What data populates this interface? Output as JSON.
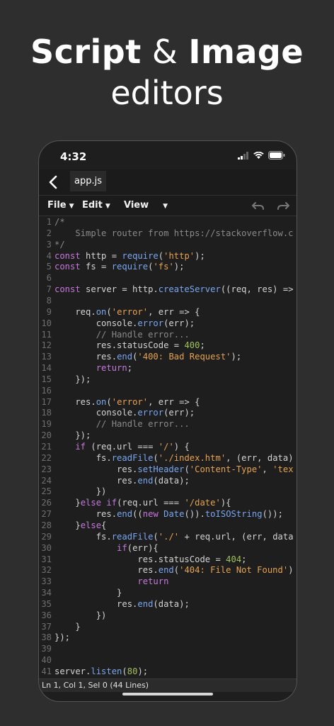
{
  "headline": {
    "line1_bold1": "Script",
    "line1_amp": "&",
    "line1_bold2": "Image",
    "line2": "editors"
  },
  "status": {
    "time": "4:32",
    "icons": [
      "signal-icon",
      "wifi-icon",
      "battery-icon"
    ]
  },
  "nav": {
    "back_icon": "chevron-left-icon",
    "file_tab": "app.js"
  },
  "menu": {
    "file": "File",
    "edit": "Edit",
    "view": "View",
    "caret": "▼",
    "undo_icon": "undo-icon",
    "redo_icon": "redo-icon"
  },
  "code_lines": [
    {
      "n": "1",
      "t": [
        [
          "c",
          "/*"
        ]
      ]
    },
    {
      "n": "2",
      "t": [
        [
          "c",
          "    Simple router from https://stackoverflow.c"
        ]
      ]
    },
    {
      "n": "3",
      "t": [
        [
          "c",
          "*/"
        ]
      ]
    },
    {
      "n": "4",
      "t": [
        [
          "k",
          "const"
        ],
        [
          "p",
          " http = "
        ],
        [
          "f",
          "require"
        ],
        [
          "p",
          "("
        ],
        [
          "s",
          "'http'"
        ],
        [
          "p",
          ");"
        ]
      ]
    },
    {
      "n": "5",
      "t": [
        [
          "k",
          "const"
        ],
        [
          "p",
          " fs = "
        ],
        [
          "f",
          "require"
        ],
        [
          "p",
          "("
        ],
        [
          "s",
          "'fs'"
        ],
        [
          "p",
          ");"
        ]
      ]
    },
    {
      "n": "6",
      "t": []
    },
    {
      "n": "7",
      "t": [
        [
          "k",
          "const"
        ],
        [
          "p",
          " server = http."
        ],
        [
          "f",
          "createServer"
        ],
        [
          "p",
          "((req, res) =>"
        ]
      ]
    },
    {
      "n": "8",
      "t": []
    },
    {
      "n": "9",
      "t": [
        [
          "p",
          "    req."
        ],
        [
          "f",
          "on"
        ],
        [
          "p",
          "("
        ],
        [
          "s",
          "'error'"
        ],
        [
          "p",
          ", err => {"
        ]
      ]
    },
    {
      "n": "10",
      "t": [
        [
          "p",
          "        console."
        ],
        [
          "f",
          "error"
        ],
        [
          "p",
          "(err);"
        ]
      ]
    },
    {
      "n": "11",
      "t": [
        [
          "c",
          "        // Handle error..."
        ]
      ]
    },
    {
      "n": "12",
      "t": [
        [
          "p",
          "        res.statusCode = "
        ],
        [
          "n",
          "400"
        ],
        [
          "p",
          ";"
        ]
      ]
    },
    {
      "n": "13",
      "t": [
        [
          "p",
          "        res."
        ],
        [
          "f",
          "end"
        ],
        [
          "p",
          "("
        ],
        [
          "s",
          "'400: Bad Request'"
        ],
        [
          "p",
          ");"
        ]
      ]
    },
    {
      "n": "14",
      "t": [
        [
          "k",
          "        return"
        ],
        [
          "p",
          ";"
        ]
      ]
    },
    {
      "n": "15",
      "t": [
        [
          "p",
          "    });"
        ]
      ]
    },
    {
      "n": "16",
      "t": []
    },
    {
      "n": "17",
      "t": [
        [
          "p",
          "    res."
        ],
        [
          "f",
          "on"
        ],
        [
          "p",
          "("
        ],
        [
          "s",
          "'error'"
        ],
        [
          "p",
          ", err => {"
        ]
      ]
    },
    {
      "n": "18",
      "t": [
        [
          "p",
          "        console."
        ],
        [
          "f",
          "error"
        ],
        [
          "p",
          "(err);"
        ]
      ]
    },
    {
      "n": "19",
      "t": [
        [
          "c",
          "        // Handle error..."
        ]
      ]
    },
    {
      "n": "20",
      "t": [
        [
          "p",
          "    });"
        ]
      ]
    },
    {
      "n": "21",
      "t": [
        [
          "k",
          "    if"
        ],
        [
          "p",
          " (req.url === "
        ],
        [
          "s",
          "'/'"
        ],
        [
          "p",
          ") {"
        ]
      ]
    },
    {
      "n": "22",
      "t": [
        [
          "p",
          "        fs."
        ],
        [
          "f",
          "readFile"
        ],
        [
          "p",
          "("
        ],
        [
          "s",
          "'./index.htm'"
        ],
        [
          "p",
          ", (err, data)"
        ]
      ]
    },
    {
      "n": "23",
      "t": [
        [
          "p",
          "            res."
        ],
        [
          "f",
          "setHeader"
        ],
        [
          "p",
          "("
        ],
        [
          "s",
          "'Content-Type'"
        ],
        [
          "p",
          ", "
        ],
        [
          "s",
          "'tex"
        ]
      ]
    },
    {
      "n": "24",
      "t": [
        [
          "p",
          "            res."
        ],
        [
          "f",
          "end"
        ],
        [
          "p",
          "(data);"
        ]
      ]
    },
    {
      "n": "25",
      "t": [
        [
          "p",
          "        })"
        ]
      ]
    },
    {
      "n": "26",
      "t": [
        [
          "p",
          "    }"
        ],
        [
          "k",
          "else if"
        ],
        [
          "p",
          "(req.url === "
        ],
        [
          "s",
          "'/date'"
        ],
        [
          "p",
          "){"
        ]
      ]
    },
    {
      "n": "27",
      "t": [
        [
          "p",
          "        res."
        ],
        [
          "f",
          "end"
        ],
        [
          "p",
          "(("
        ],
        [
          "k",
          "new"
        ],
        [
          "p",
          " "
        ],
        [
          "f",
          "Date"
        ],
        [
          "p",
          "())."
        ],
        [
          "f",
          "toISOString"
        ],
        [
          "p",
          "());"
        ]
      ]
    },
    {
      "n": "28",
      "t": [
        [
          "p",
          "    }"
        ],
        [
          "k",
          "else"
        ],
        [
          "p",
          "{"
        ]
      ]
    },
    {
      "n": "29",
      "t": [
        [
          "p",
          "        fs."
        ],
        [
          "f",
          "readFile"
        ],
        [
          "p",
          "("
        ],
        [
          "s",
          "'./'"
        ],
        [
          "p",
          " + req.url, (err, data"
        ]
      ]
    },
    {
      "n": "30",
      "t": [
        [
          "k",
          "            if"
        ],
        [
          "p",
          "(err){"
        ]
      ]
    },
    {
      "n": "31",
      "t": [
        [
          "p",
          "                res.statusCode = "
        ],
        [
          "n",
          "404"
        ],
        [
          "p",
          ";"
        ]
      ]
    },
    {
      "n": "32",
      "t": [
        [
          "p",
          "                res."
        ],
        [
          "f",
          "end"
        ],
        [
          "p",
          "("
        ],
        [
          "s",
          "'404: File Not Found'"
        ],
        [
          "p",
          ")"
        ]
      ]
    },
    {
      "n": "33",
      "t": [
        [
          "k",
          "                return"
        ]
      ]
    },
    {
      "n": "34",
      "t": [
        [
          "p",
          "            }"
        ]
      ]
    },
    {
      "n": "35",
      "t": [
        [
          "p",
          "            res."
        ],
        [
          "f",
          "end"
        ],
        [
          "p",
          "(data);"
        ]
      ]
    },
    {
      "n": "36",
      "t": [
        [
          "p",
          "        })"
        ]
      ]
    },
    {
      "n": "37",
      "t": [
        [
          "p",
          "    }"
        ]
      ]
    },
    {
      "n": "38",
      "t": [
        [
          "p",
          "});"
        ]
      ]
    },
    {
      "n": "39",
      "t": []
    },
    {
      "n": "40",
      "t": []
    },
    {
      "n": "41",
      "t": [
        [
          "p",
          "server."
        ],
        [
          "f",
          "listen"
        ],
        [
          "p",
          "("
        ],
        [
          "n",
          "80"
        ],
        [
          "p",
          ");"
        ]
      ]
    }
  ],
  "footer": {
    "status": "Ln 1, Col 1, Sel 0 (44 Lines)"
  },
  "colors": {
    "background": "#2e2e2e",
    "editor": "#1e1e1e",
    "keyword": "#c678dd",
    "string": "#e5a252",
    "number": "#a0c15c",
    "function": "#7aa6f0",
    "comment": "#8a8a8a"
  }
}
